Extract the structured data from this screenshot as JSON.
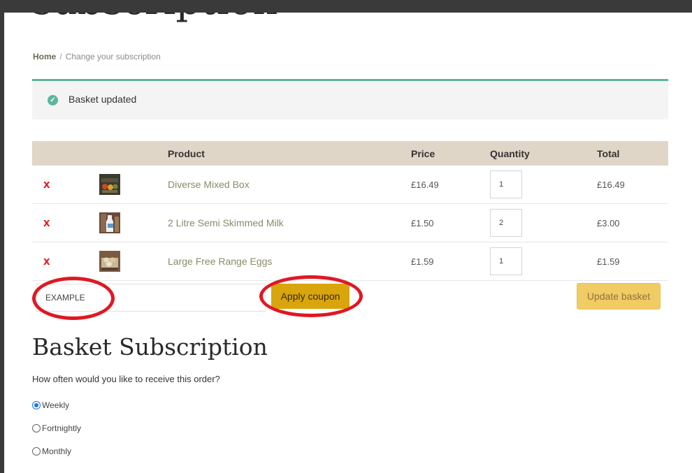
{
  "page": {
    "title": "subscription",
    "breadcrumb": {
      "home": "Home",
      "separator": "/",
      "current": "Change your subscription"
    }
  },
  "notice": {
    "icon": "check-circle-icon",
    "text": "Basket updated"
  },
  "cart": {
    "headers": {
      "product": "Product",
      "price": "Price",
      "quantity": "Quantity",
      "total": "Total"
    },
    "remove_symbol": "x",
    "items": [
      {
        "name": "Diverse Mixed Box",
        "price": "£16.49",
        "quantity": "1",
        "total": "£16.49",
        "thumb": "mixed-box"
      },
      {
        "name": "2 Litre Semi Skimmed Milk",
        "price": "£1.50",
        "quantity": "2",
        "total": "£3.00",
        "thumb": "milk"
      },
      {
        "name": "Large Free Range Eggs",
        "price": "£1.59",
        "quantity": "1",
        "total": "£1.59",
        "thumb": "eggs"
      }
    ]
  },
  "coupon": {
    "value": "EXAMPLE",
    "apply_label": "Apply coupon"
  },
  "update_label": "Update basket",
  "subscription": {
    "title": "Basket Subscription",
    "question": "How often would you like to receive this order?",
    "options": [
      {
        "label": "Weekly",
        "checked": true
      },
      {
        "label": "Fortnightly",
        "checked": false
      },
      {
        "label": "Monthly",
        "checked": false
      }
    ]
  },
  "colors": {
    "accent_green": "#5cb59c",
    "header_beige": "#e0d6c8",
    "coupon_button": "#d9a50c",
    "update_button": "#f1cb63",
    "remove_red": "#e01010",
    "annotation_red": "#e01822"
  }
}
